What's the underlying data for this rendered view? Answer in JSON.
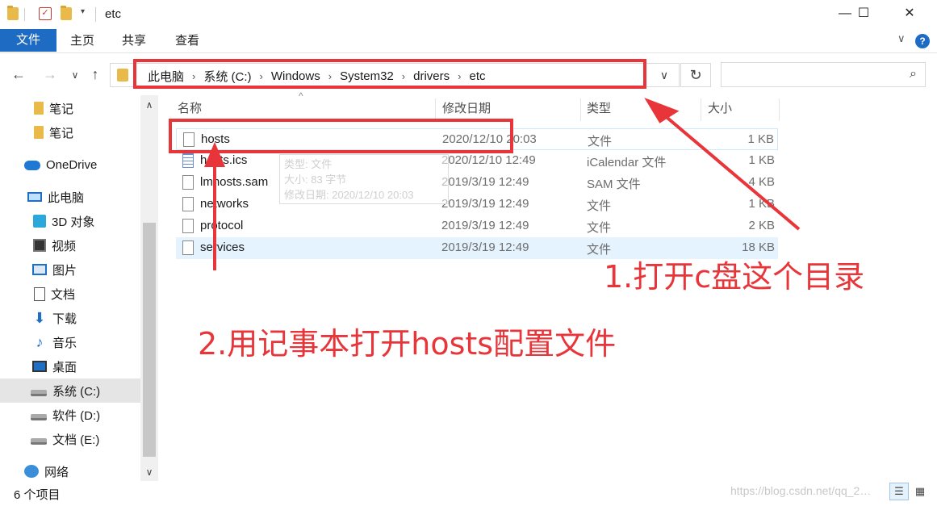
{
  "window": {
    "title": "etc",
    "minimize": "—",
    "maximize": "☐",
    "close": "✕"
  },
  "ribbon": {
    "tabs": [
      "文件",
      "主页",
      "共享",
      "查看"
    ],
    "collapse": "∨",
    "help": "?"
  },
  "nav": {
    "back": "←",
    "forward": "→",
    "recent": "∨",
    "up": "↑",
    "breadcrumbs": [
      "此电脑",
      "系统 (C:)",
      "Windows",
      "System32",
      "drivers",
      "etc"
    ],
    "separator": "›",
    "dropdown": "∨",
    "refresh": "↻",
    "search_icon": "⌕",
    "search_placeholder": ""
  },
  "sidebar": {
    "items": [
      {
        "label": "笔记",
        "icon": "folder-icon"
      },
      {
        "label": "笔记",
        "icon": "folder-icon"
      },
      {
        "label": "OneDrive",
        "icon": "cloud-icon"
      },
      {
        "label": "此电脑",
        "icon": "computer-icon"
      },
      {
        "label": "3D 对象",
        "icon": "3d-objects-icon"
      },
      {
        "label": "视频",
        "icon": "video-icon"
      },
      {
        "label": "图片",
        "icon": "pictures-icon"
      },
      {
        "label": "文档",
        "icon": "documents-icon"
      },
      {
        "label": "下载",
        "icon": "download-icon"
      },
      {
        "label": "音乐",
        "icon": "music-icon"
      },
      {
        "label": "桌面",
        "icon": "desktop-icon"
      },
      {
        "label": "系统 (C:)",
        "icon": "drive-icon",
        "selected": true
      },
      {
        "label": "软件 (D:)",
        "icon": "drive-icon"
      },
      {
        "label": "文档 (E:)",
        "icon": "drive-icon"
      },
      {
        "label": "网络",
        "icon": "network-icon"
      }
    ],
    "scroll_up": "∧",
    "scroll_down": "∨"
  },
  "filelist": {
    "columns": {
      "name": "名称",
      "modified": "修改日期",
      "type": "类型",
      "size": "大小"
    },
    "sort_indicator": "^",
    "rows": [
      {
        "name": "hosts",
        "modified": "2020/12/10 20:03",
        "type": "文件",
        "size": "1 KB",
        "icon": "file-icon"
      },
      {
        "name": "hosts.ics",
        "modified": "2020/12/10 12:49",
        "type": "iCalendar 文件",
        "size": "1 KB",
        "icon": "calendar-file-icon"
      },
      {
        "name": "lmhosts.sam",
        "modified": "2019/3/19 12:49",
        "type": "SAM 文件",
        "size": "4 KB",
        "icon": "file-icon"
      },
      {
        "name": "networks",
        "modified": "2019/3/19 12:49",
        "type": "文件",
        "size": "1 KB",
        "icon": "file-icon"
      },
      {
        "name": "protocol",
        "modified": "2019/3/19 12:49",
        "type": "文件",
        "size": "2 KB",
        "icon": "file-icon"
      },
      {
        "name": "services",
        "modified": "2019/3/19 12:49",
        "type": "文件",
        "size": "18 KB",
        "icon": "file-icon",
        "selected": true
      }
    ],
    "tooltip": [
      "类型: 文件",
      "大小: 83 字节",
      "修改日期: 2020/12/10 20:03"
    ]
  },
  "status": {
    "item_count": "6 个项目",
    "watermark": "https://blog.csdn.net/qq_2…"
  },
  "annotations": {
    "step1": "1.打开c盘这个目录",
    "step2": "2.用记事本打开hosts配置文件",
    "color": "#e8353a"
  },
  "colors": {
    "accent": "#1e6bc4",
    "selected_row": "#e5f3ff",
    "sidebar_selected": "#e5e5e5"
  }
}
